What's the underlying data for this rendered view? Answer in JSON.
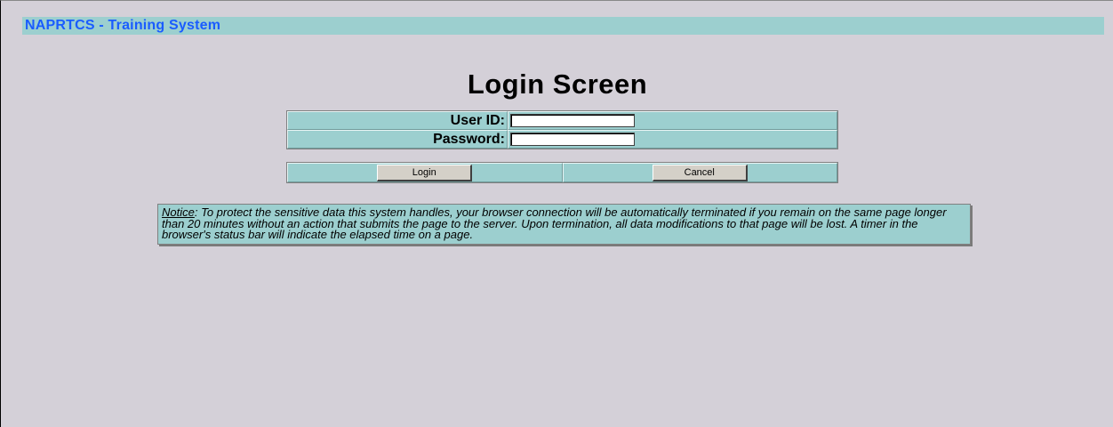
{
  "header": {
    "app_title": "NAPRTCS - Training System"
  },
  "main": {
    "page_title": "Login Screen",
    "form": {
      "user_id_label": "User ID:",
      "user_id_value": "",
      "password_label": "Password:",
      "password_value": ""
    },
    "buttons": {
      "login_label": "Login",
      "cancel_label": "Cancel"
    },
    "notice": {
      "label": "Notice",
      "text": ": To protect the sensitive data this system handles, your browser connection will be automatically terminated if you remain on the same page longer than 20 minutes without an action that submits the page to the server. Upon termination, all data modifications to that page will be lost. A timer in the browser's status bar will indicate the elapsed time on a page."
    }
  },
  "colors": {
    "background": "#d4d0d8",
    "panel": "#9ccfcf",
    "title_text": "#1a5cff",
    "button_face": "#d4d0c8"
  }
}
